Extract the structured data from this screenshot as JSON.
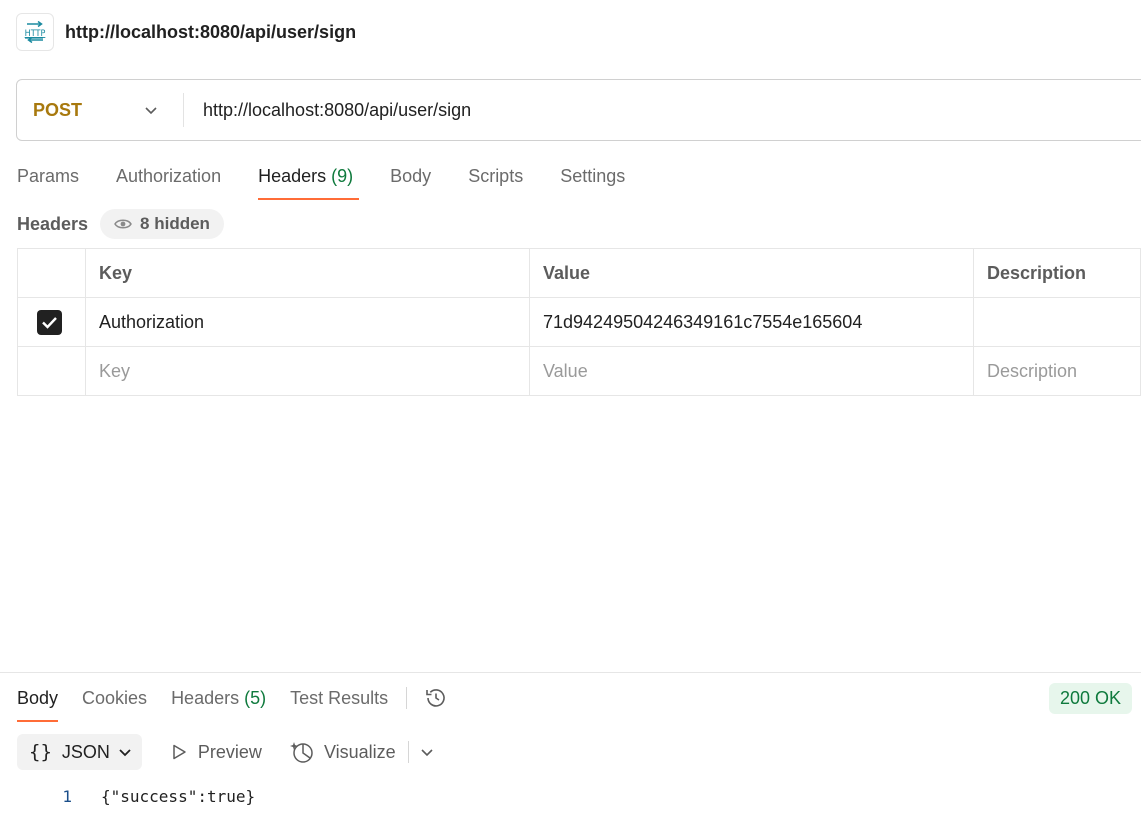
{
  "request": {
    "title": "http://localhost:8080/api/user/sign",
    "icon": "http-icon",
    "method": "POST",
    "url": "http://localhost:8080/api/user/sign",
    "tabs": [
      {
        "label": "Params",
        "count": ""
      },
      {
        "label": "Authorization",
        "count": ""
      },
      {
        "label": "Headers",
        "count": "(9)"
      },
      {
        "label": "Body",
        "count": ""
      },
      {
        "label": "Scripts",
        "count": ""
      },
      {
        "label": "Settings",
        "count": ""
      }
    ],
    "active_tab": "Headers"
  },
  "headers": {
    "label": "Headers",
    "hidden_label": "8 hidden",
    "columns": {
      "key": "Key",
      "value": "Value",
      "description": "Description"
    },
    "rows": [
      {
        "checked": true,
        "key": "Authorization",
        "value": "71d94249504246349161c7554e165604",
        "description": ""
      }
    ],
    "new_row": {
      "key_placeholder": "Key",
      "value_placeholder": "Value",
      "description_placeholder": "Description"
    }
  },
  "response": {
    "tabs": [
      {
        "label": "Body",
        "count": ""
      },
      {
        "label": "Cookies",
        "count": ""
      },
      {
        "label": "Headers",
        "count": "(5)"
      },
      {
        "label": "Test Results",
        "count": ""
      }
    ],
    "active_tab": "Body",
    "status": "200 OK",
    "format": {
      "braces": "{}",
      "label": "JSON"
    },
    "preview_label": "Preview",
    "visualize_label": "Visualize",
    "lines": [
      {
        "number": "1",
        "text": "{\"success\":true}"
      }
    ]
  },
  "colors": {
    "method": "#a8790e",
    "accent": "#ff6c37",
    "success": "#0f7a3d"
  }
}
